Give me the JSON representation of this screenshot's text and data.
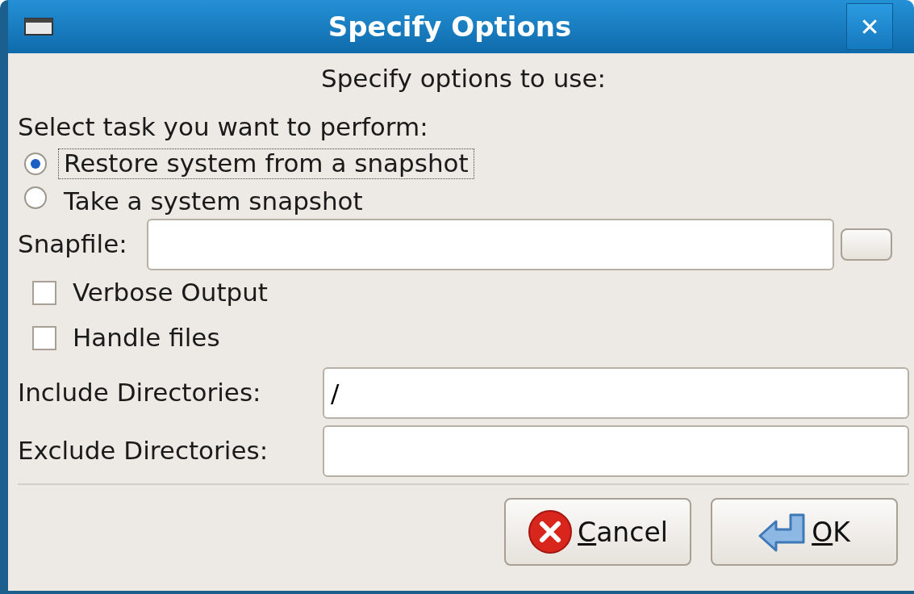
{
  "window": {
    "title": "Specify Options",
    "close": "✕"
  },
  "heading": "Specify options to use:",
  "task": {
    "label": "Select task you want to perform:",
    "options": [
      {
        "label": "Restore system from a snapshot",
        "selected": true,
        "focused": true
      },
      {
        "label": "Take a system snapshot",
        "selected": false,
        "focused": false
      }
    ]
  },
  "snapfile": {
    "label": "Snapfile:"
  },
  "checkboxes": [
    {
      "label": "Verbose Output",
      "checked": false
    },
    {
      "label": "Handle files",
      "checked": false
    }
  ],
  "directories": [
    {
      "label": "Include Directories:",
      "value": "/"
    },
    {
      "label": "Exclude Directories:"
    }
  ],
  "buttons": [
    {
      "kind": "cancel",
      "label": "Cancel",
      "mnemonic_underlined": true
    },
    {
      "kind": "ok",
      "label": "OK",
      "mnemonic_underlined": true
    }
  ]
}
